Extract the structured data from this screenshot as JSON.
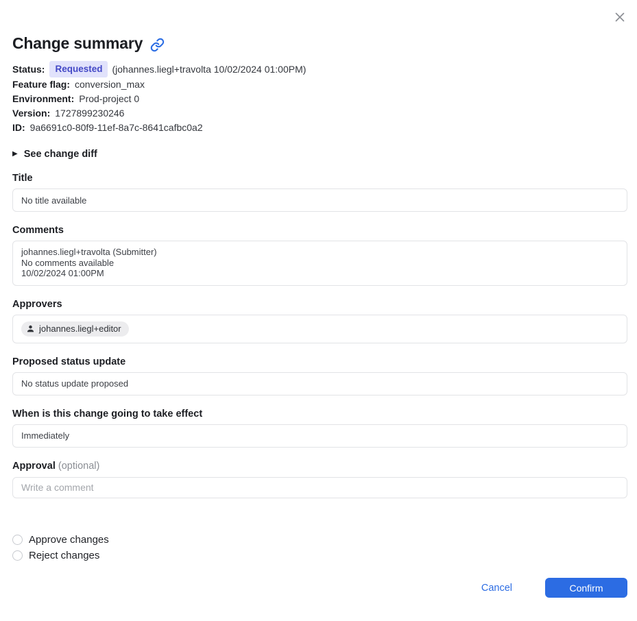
{
  "modal": {
    "title": "Change summary"
  },
  "meta": {
    "status_label": "Status:",
    "status_badge": "Requested",
    "status_detail": "(johannes.liegl+travolta 10/02/2024 01:00PM)",
    "rows": [
      {
        "label": "Feature flag:",
        "value": "conversion_max"
      },
      {
        "label": "Environment:",
        "value": "Prod-project 0"
      },
      {
        "label": "Version:",
        "value": "1727899230246"
      },
      {
        "label": "ID:",
        "value": "9a6691c0-80f9-11ef-8a7c-8641cafbc0a2"
      }
    ]
  },
  "disclosure": {
    "label": "See change diff"
  },
  "sections": {
    "title_field": {
      "label": "Title",
      "value": "No title available"
    },
    "comments": {
      "label": "Comments",
      "lines": [
        "johannes.liegl+travolta (Submitter)",
        "No comments available",
        "10/02/2024 01:00PM"
      ]
    },
    "approvers": {
      "label": "Approvers",
      "chip": "johannes.liegl+editor"
    },
    "proposed_status": {
      "label": "Proposed status update",
      "value": "No status update proposed"
    },
    "effect": {
      "label": "When is this change going to take effect",
      "value": "Immediately"
    },
    "approval": {
      "label": "Approval",
      "optional": "(optional)",
      "placeholder": "Write a comment"
    }
  },
  "choices": [
    {
      "label": "Approve changes"
    },
    {
      "label": "Reject changes"
    }
  ],
  "footer": {
    "cancel_label": "Cancel",
    "confirm_label": "Confirm"
  },
  "colors": {
    "accent_blue": "#2c6ce3",
    "badge_bg": "#e1e2fb",
    "badge_text": "#4348c6"
  }
}
